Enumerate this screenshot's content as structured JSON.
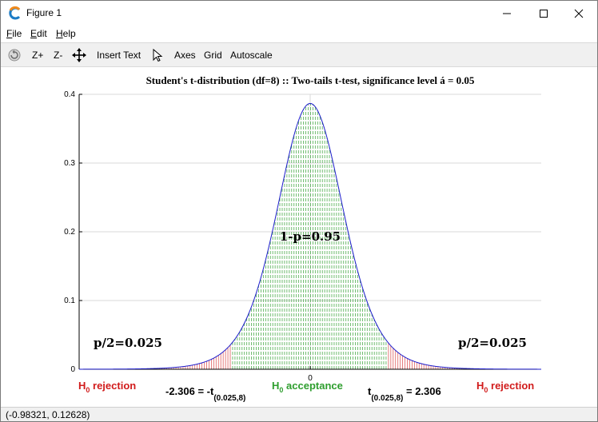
{
  "window": {
    "title": "Figure 1",
    "minimize_icon": "minimize-icon",
    "maximize_icon": "maximize-icon",
    "close_icon": "close-icon"
  },
  "menu": {
    "file": {
      "accel": "F",
      "rest": "ile"
    },
    "edit": {
      "accel": "E",
      "rest": "dit"
    },
    "help": {
      "accel": "H",
      "rest": "elp"
    }
  },
  "toolbar": {
    "rotate_icon": "rotate-icon",
    "zoom_in": "Z+",
    "zoom_out": "Z-",
    "pan_icon": "pan-icon",
    "insert_text": "Insert Text",
    "select_icon": "pointer-icon",
    "axes": "Axes",
    "grid": "Grid",
    "autoscale": "Autoscale"
  },
  "status": {
    "coordinates": "(-0.98321, 0.12628)"
  },
  "colors": {
    "curve": "#1d1dcc",
    "acceptance": "#2e9e2e",
    "rejection": "#d11b1b",
    "grid": "#d9d9d9",
    "axis": "#000000"
  },
  "chart_data": {
    "type": "line",
    "title": "Student's t-distribution (df=8) :: Two-tails t-test, significance level á = 0.05",
    "xlabel": "",
    "ylabel": "",
    "df": 8,
    "critical_value": 2.306,
    "xlim": [
      -6.85,
      6.85
    ],
    "ylim": [
      0,
      0.4
    ],
    "grid": true,
    "x_ticks": [
      "0"
    ],
    "y_ticks": [
      "0",
      "0.1",
      "0.2",
      "0.3",
      "0.4"
    ],
    "series": [
      {
        "x": [
          -6.85,
          -6,
          -5,
          -4,
          -3,
          -2.306,
          -2,
          -1.5,
          -1,
          -0.5,
          0,
          0.5,
          1,
          1.5,
          2,
          2.306,
          3,
          4,
          5,
          6,
          6.85
        ],
        "y": [
          0.0005,
          0.0011,
          0.0025,
          0.0067,
          0.0205,
          0.0381,
          0.0506,
          0.1272,
          0.2304,
          0.3441,
          0.3867,
          0.3441,
          0.2304,
          0.1272,
          0.0506,
          0.0381,
          0.0205,
          0.0067,
          0.0025,
          0.0011,
          0.0005
        ]
      }
    ],
    "annotations": {
      "center": "1-p=0.95",
      "left_tail": "p/2=0.025",
      "right_tail": "p/2=0.025",
      "left_rejection": {
        "h": "H",
        "sub": "0",
        "text": " rejection"
      },
      "acceptance": {
        "h": "H",
        "sub": "0",
        "text": " acceptance"
      },
      "right_rejection": {
        "h": "H",
        "sub": "0",
        "text": " rejection"
      },
      "left_critical": {
        "pre": "-2.306 = -t",
        "sub": "(0.025,8)"
      },
      "right_critical": {
        "pre": "t",
        "sub": "(0.025,8)",
        "post": " = 2.306"
      }
    }
  }
}
